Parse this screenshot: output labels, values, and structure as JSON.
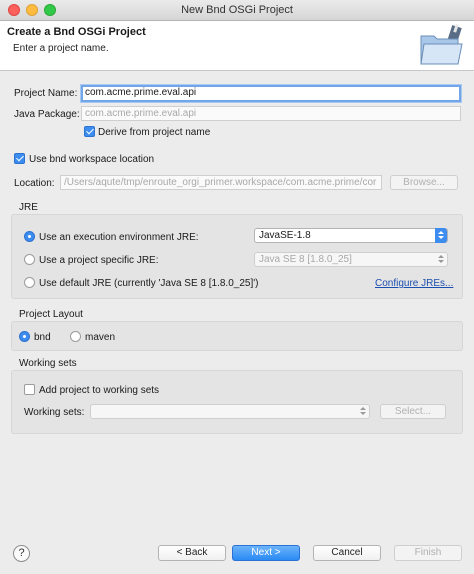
{
  "window": {
    "title": "New Bnd OSGi Project"
  },
  "banner": {
    "title": "Create a Bnd OSGi Project",
    "message": "Enter a project name.",
    "icon": "folder-wizard-icon"
  },
  "project": {
    "name_label": "Project Name:",
    "name_value": "com.acme.prime.eval.api",
    "package_label": "Java Package:",
    "package_value": "com.acme.prime.eval.api",
    "derive_label": "Derive from project name",
    "derive_checked": true
  },
  "workspace": {
    "use_label": "Use bnd workspace location",
    "use_checked": true,
    "location_label": "Location:",
    "location_value": "/Users/aqute/tmp/enroute_orgi_primer.workspace/com.acme.prime/cor",
    "browse_label": "Browse..."
  },
  "jre": {
    "group_title": "JRE",
    "exec_env_label": "Use an execution environment JRE:",
    "exec_env_value": "JavaSE-1.8",
    "specific_label": "Use a project specific JRE:",
    "specific_value": "Java SE 8 [1.8.0_25]",
    "default_label": "Use default JRE (currently 'Java SE 8 [1.8.0_25]')",
    "configure_link": "Configure JREs..."
  },
  "layout": {
    "group_title": "Project Layout",
    "bnd_label": "bnd",
    "maven_label": "maven"
  },
  "working_sets": {
    "group_title": "Working sets",
    "add_label": "Add project to working sets",
    "sets_label": "Working sets:",
    "select_label": "Select..."
  },
  "footer": {
    "help": "?",
    "back": "< Back",
    "next": "Next >",
    "cancel": "Cancel",
    "finish": "Finish"
  },
  "colors": {
    "accent": "#3d8cf0",
    "link": "#1a4fb0",
    "focus": "#72a6e8"
  }
}
